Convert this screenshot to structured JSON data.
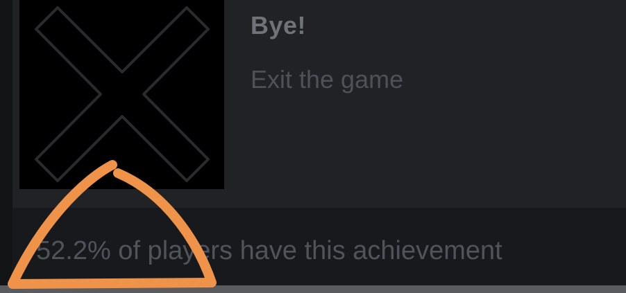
{
  "achievement": {
    "title": "Bye!",
    "description": "Exit the game",
    "icon": "x-cross-icon",
    "unlock_text": "52.2% of players have this achievement",
    "unlock_percent": 52.2
  },
  "annotation": {
    "shape": "hand-drawn-triangle-marker",
    "color": "#f0934a"
  },
  "colors": {
    "background": "#1a1b1e",
    "card": "#202226",
    "footer": "#18191c",
    "title_text": "#6f7278",
    "desc_text": "#4e5157"
  }
}
